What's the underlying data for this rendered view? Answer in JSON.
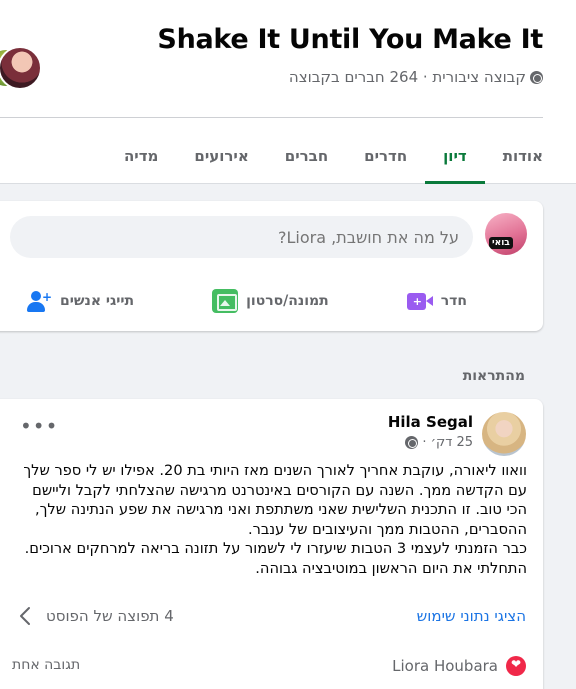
{
  "group": {
    "title": "Shake It Until You Make It",
    "meta": "קבוצה ציבורית · 264 חברים בקבוצה"
  },
  "tabs": [
    {
      "label": "אודות",
      "active": false
    },
    {
      "label": "דיון",
      "active": true
    },
    {
      "label": "חדרים",
      "active": false
    },
    {
      "label": "חברים",
      "active": false
    },
    {
      "label": "אירועים",
      "active": false
    },
    {
      "label": "מדיה",
      "active": false
    }
  ],
  "composer": {
    "placeholder": "על מה את חושבת, Liora?",
    "avatar_tag": "בואי",
    "actions": {
      "room": "חדר",
      "photo_video": "תמונה/סרטון",
      "tag_people": "תייגי אנשים"
    }
  },
  "section_title": "מהתראות",
  "post": {
    "author": "Hila Segal",
    "time": "25 דק׳ ·",
    "body": [
      "וואוו ליאורה, עוקבת אחריך לאורך השנים מאז היותי בת 20. אפילו יש לי ספר שלך עם הקדשה ממך. השנה עם הקורסים באינטרנט מרגישה שהצלחתי לקבל וליישם הכי טוב. זו התכנית השלישית שאני משתתפת ואני מרגישה את שפע הנתינה שלך, ההסברים, ההטבות ממך והעיצובים של ענבר.",
      "כבר הזמנתי לעצמי 3 הטבות שיעזרו לי לשמור על תזונה בריאה למרחקים ארוכים. התחלתי את היום הראשון במוטיבציה גבוהה."
    ],
    "insights_link": "הציגי נתוני שימוש",
    "preview_count": "4 תפוצה של הפוסט",
    "reactor": "Liora Houbara",
    "comments": "תגובה אחת"
  },
  "colors": {
    "accent_green": "#0a7a3b",
    "link_blue": "#1b74e4",
    "reaction_red": "#f02849"
  },
  "icons": [
    "globe-icon",
    "video-room-icon",
    "photo-icon",
    "tag-people-icon",
    "more-icon",
    "chevron-left-icon",
    "heart-icon"
  ]
}
